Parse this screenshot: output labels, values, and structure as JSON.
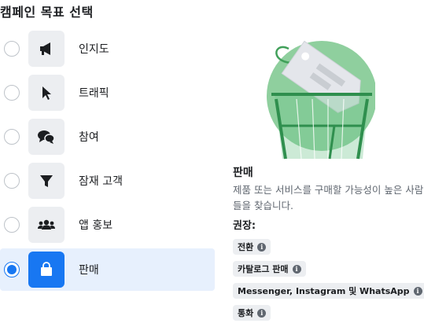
{
  "header": {
    "title": "캠페인 목표 선택"
  },
  "options": [
    {
      "label": "인지도",
      "icon": "megaphone-icon",
      "selected": false
    },
    {
      "label": "트래픽",
      "icon": "cursor-icon",
      "selected": false
    },
    {
      "label": "참여",
      "icon": "chat-bubbles-icon",
      "selected": false
    },
    {
      "label": "잠재 고객",
      "icon": "funnel-icon",
      "selected": false
    },
    {
      "label": "앱 홍보",
      "icon": "people-icon",
      "selected": false
    },
    {
      "label": "판매",
      "icon": "shopping-bag-icon",
      "selected": true
    }
  ],
  "detail": {
    "title": "판매",
    "description": "제품 또는 서비스를 구매할 가능성이 높은 사람들을 찾습니다.",
    "recommended_label": "권장:",
    "chips": [
      "전환",
      "카탈로그 판매",
      "Messenger, Instagram 및 WhatsApp",
      "통화"
    ]
  },
  "colors": {
    "accent": "#1877f2",
    "selected_bg": "#e7f0fd",
    "illustration_green": "#6cc38a"
  }
}
